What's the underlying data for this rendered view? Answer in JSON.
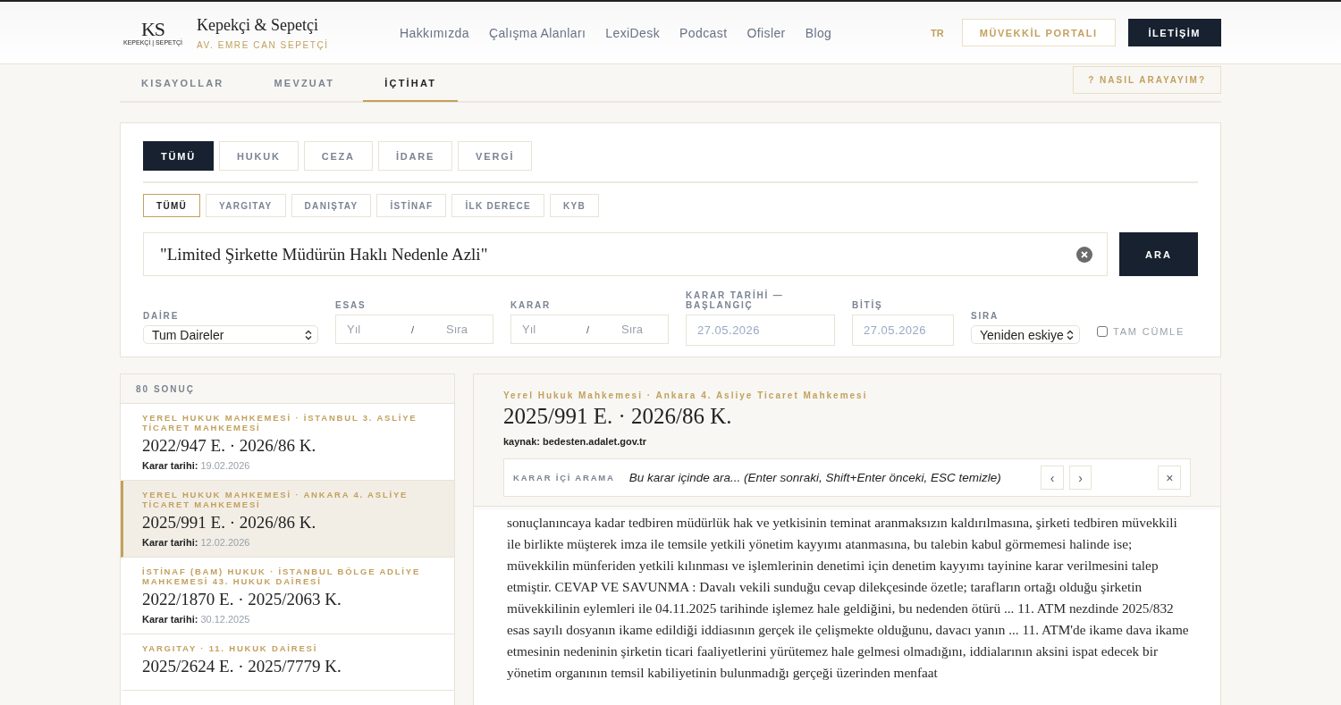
{
  "header": {
    "logo": {
      "monogram": "KS",
      "caption": "KEPEKÇİ | SEPETÇİ"
    },
    "brand": "Kepekçi & Sepetçi",
    "subtitle": "AV. EMRE CAN SEPETÇİ",
    "nav": [
      "Hakkımızda",
      "Çalışma Alanları",
      "LexiDesk",
      "Podcast",
      "Ofisler",
      "Blog"
    ],
    "language": "TR",
    "portal_button": "MÜVEKKİL PORTALI",
    "contact_button": "İLETİŞİM"
  },
  "section_tabs": [
    {
      "label": "KISAYOLLAR",
      "selected": false
    },
    {
      "label": "MEVZUAT",
      "selected": false
    },
    {
      "label": "İÇTİHAT",
      "selected": true
    }
  ],
  "help_button": "? NASIL ARAYAYIM?",
  "filters": {
    "categories": [
      {
        "label": "TÜMÜ",
        "selected": true
      },
      {
        "label": "HUKUK",
        "selected": false
      },
      {
        "label": "CEZA",
        "selected": false
      },
      {
        "label": "İDARE",
        "selected": false
      },
      {
        "label": "VERGİ",
        "selected": false
      }
    ],
    "courts": [
      {
        "label": "TÜMÜ",
        "selected": true
      },
      {
        "label": "YARGITAY",
        "selected": false
      },
      {
        "label": "DANIŞTAY",
        "selected": false
      },
      {
        "label": "İSTİNAF",
        "selected": false
      },
      {
        "label": "İLK DERECE",
        "selected": false
      },
      {
        "label": "KYB",
        "selected": false
      }
    ],
    "query": "\"Limited Şirkette Müdürün Haklı Nedenle Azli\"",
    "search_button": "ARA",
    "daire": {
      "label": "DAİRE",
      "value": "Tum Daireler"
    },
    "esas": {
      "label": "ESAS",
      "year_placeholder": "Yıl",
      "separator": "/",
      "seq_placeholder": "Sıra"
    },
    "karar": {
      "label": "KARAR",
      "year_placeholder": "Yıl",
      "separator": "/",
      "seq_placeholder": "Sıra"
    },
    "date_start": {
      "label": "KARAR TARİHİ — BAŞLANGIÇ",
      "value": "27.05.2026"
    },
    "date_end": {
      "label": "BİTİŞ",
      "value": "27.05.2026"
    },
    "sort": {
      "label": "SIRA",
      "value": "Yeniden eskiye"
    },
    "exact": {
      "label": "TAM CÜMLE",
      "checked": false
    }
  },
  "results": {
    "count": "80 SONUÇ",
    "items": [
      {
        "court": "YEREL HUKUK MAHKEMESİ · İSTANBUL 3. ASLİYE TİCARET MAHKEMESİ",
        "number": "2022/947 E. · 2026/86 K.",
        "date_label": "Karar tarihi:",
        "date": "19.02.2026",
        "selected": false
      },
      {
        "court": "YEREL HUKUK MAHKEMESİ · ANKARA 4. ASLİYE TİCARET MAHKEMESİ",
        "number": "2025/991 E. · 2026/86 K.",
        "date_label": "Karar tarihi:",
        "date": "12.02.2026",
        "selected": true
      },
      {
        "court": "İSTİNAF (BAM) HUKUK · İSTANBUL BÖLGE ADLİYE MAHKEMESİ 43. HUKUK DAİRESİ",
        "number": "2022/1870 E. · 2025/2063 K.",
        "date_label": "Karar tarihi:",
        "date": "30.12.2025",
        "selected": false
      },
      {
        "court": "YARGITAY · 11. HUKUK DAİRESİ",
        "number": "2025/2624 E. · 2025/7779 K.",
        "selected": false
      }
    ]
  },
  "detail": {
    "court": "Yerel Hukuk Mahkemesi · Ankara 4. Asliye Ticaret Mahkemesi",
    "title": "2025/991 E. · 2026/86 K.",
    "source": "kaynak: bedesten.adalet.gov.tr",
    "in_search": {
      "label": "KARAR İÇİ ARAMA",
      "placeholder": "Bu karar içinde ara... (Enter sonraki, Shift+Enter önceki, ESC temizle)",
      "prev": "‹",
      "next": "›",
      "close": "×"
    },
    "body": "sonuçlanıncaya kadar tedbiren müdürlük hak ve yetkisinin teminat aranmaksızın kaldırılmasına, şirketi tedbiren müvekkili ile birlikte müşterek imza ile temsile yetkili yönetim kayyımı atanmasına, bu talebin kabul görmemesi halinde ise; müvekkilin münferiden yetkili kılınması ve işlemlerinin denetimi için denetim kayyımı tayinine karar verilmesini talep etmiştir. CEVAP VE SAVUNMA : Davalı vekili sunduğu cevap dilekçesinde özetle; tarafların ortağı olduğu şirketin müvekkilinin eylemleri ile 04.11.2025 tarihinde işlemez hale geldiğini, bu nedenden ötürü ... 11. ATM nezdinde 2025/832 esas sayılı dosyanın ikame edildiği iddiasının gerçek ile çelişmekte olduğunu, davacı yanın ... 11. ATM'de ikame dava ikame etmesinin nedeninin şirketin ticari faaliyetlerini yürütemez hale gelmesi olmadığını, iddialarının aksini ispat edecek bir yönetim organının temsil kabiliyetinin bulunmadığı gerçeği üzerinden menfaat"
  }
}
